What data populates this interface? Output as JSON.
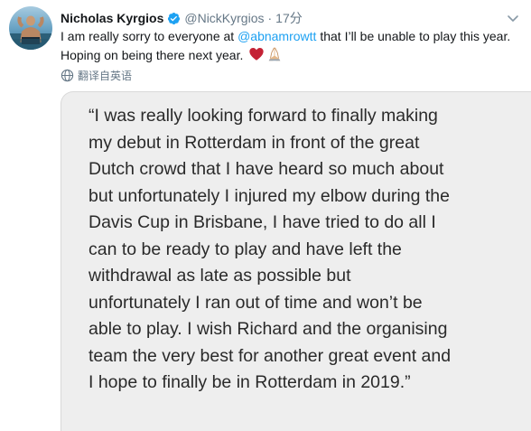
{
  "tweet": {
    "display_name": "Nicholas Kyrgios",
    "handle": "@NickKyrgios",
    "separator": "·",
    "timestamp": "17分",
    "text_before": "I am really sorry to everyone at ",
    "mention": "@abnamrowtt",
    "text_after_line1": " that I’ll be unable to play this year.",
    "text_line2": "Hoping on being there next year. ",
    "emojis": [
      "heart-icon",
      "praying-hands-icon"
    ]
  },
  "translate": {
    "label": "翻译自英语",
    "icon": "globe-icon"
  },
  "quote_image": {
    "lines": [
      "“I was really looking forward to finally making",
      "my debut in Rotterdam in front of the great",
      "Dutch crowd that I have heard so much about",
      "but unfortunately I injured my elbow during the",
      "Davis Cup in Brisbane, I have tried to do all I",
      "can to be ready to play and have left the",
      "withdrawal as late as possible but",
      "unfortunately I ran out of time and won’t be",
      "able to play. I wish Richard and the organising",
      "team the very best for another great event and",
      "I hope to finally be in Rotterdam in 2019.”"
    ]
  },
  "colors": {
    "mention": "#1da1f2",
    "verified": "#1da1f2",
    "text": "#14171a",
    "muted": "#657786",
    "media_bg": "#eeeeee"
  }
}
